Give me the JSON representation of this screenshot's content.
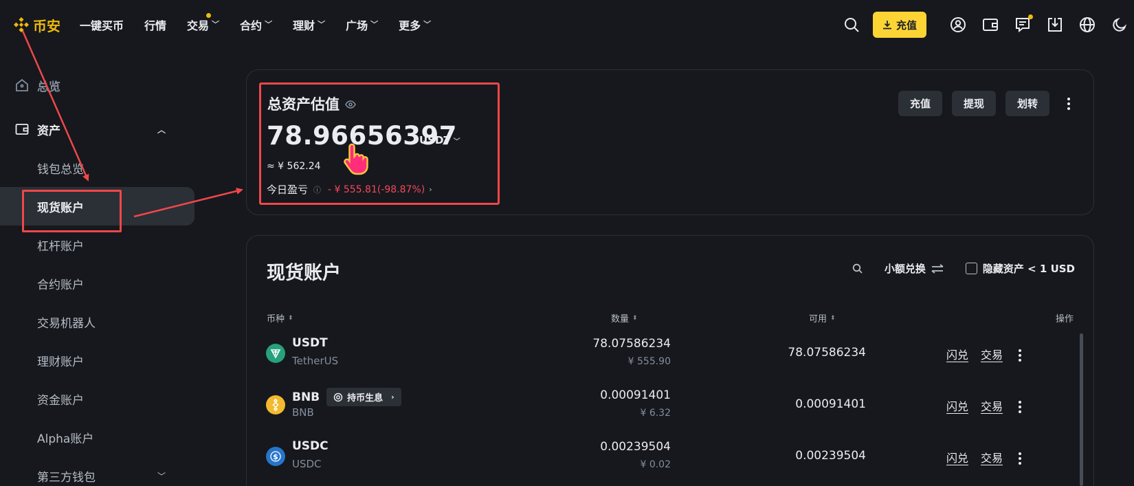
{
  "brand": {
    "name": "币安",
    "color": "#f0b90b"
  },
  "nav": {
    "items": [
      {
        "label": "一键买币",
        "dropdown": false,
        "dot": false
      },
      {
        "label": "行情",
        "dropdown": false,
        "dot": false
      },
      {
        "label": "交易",
        "dropdown": true,
        "dot": true
      },
      {
        "label": "合约",
        "dropdown": true,
        "dot": false
      },
      {
        "label": "理财",
        "dropdown": true,
        "dot": false
      },
      {
        "label": "广场",
        "dropdown": true,
        "dot": false
      },
      {
        "label": "更多",
        "dropdown": true,
        "dot": false
      }
    ],
    "deposit_label": "充值",
    "icons": [
      "search-icon",
      "download-icon",
      "user-icon",
      "wallet-icon",
      "message-icon",
      "download-app-icon",
      "globe-icon",
      "moon-icon"
    ]
  },
  "sidebar": {
    "overview": "总览",
    "assets": "资产",
    "sub_items": [
      "钱包总览",
      "现货账户",
      "杠杆账户",
      "合约账户",
      "交易机器人",
      "理财账户",
      "资金账户",
      "Alpha账户",
      "第三方钱包"
    ],
    "active": "现货账户"
  },
  "estimate": {
    "title": "总资产估值",
    "value": "78.96656397",
    "unit": "USDT",
    "cny": "≈ ¥ 562.24",
    "pnl_label": "今日盈亏",
    "pnl_value": "- ¥ 555.81(-98.87%)",
    "buttons": [
      "充值",
      "提现",
      "划转"
    ]
  },
  "spot": {
    "title": "现货账户",
    "dust_label": "小额兑换",
    "hide_label": "隐藏资产 < 1 USD",
    "columns": {
      "coin": "币种",
      "amount": "数量",
      "available": "可用",
      "action": "操作"
    },
    "rows": [
      {
        "symbol": "USDT",
        "name": "TetherUS",
        "amount": "78.07586234",
        "cny": "¥ 555.90",
        "available": "78.07586234",
        "tag": "",
        "color": "#26a17b"
      },
      {
        "symbol": "BNB",
        "name": "BNB",
        "amount": "0.00091401",
        "cny": "¥ 6.32",
        "available": "0.00091401",
        "tag": "持币生息",
        "color": "#f3ba2f"
      },
      {
        "symbol": "USDC",
        "name": "USDC",
        "amount": "0.00239504",
        "cny": "¥ 0.02",
        "available": "0.00239504",
        "tag": "",
        "color": "#2775ca"
      }
    ],
    "actions": [
      "闪兑",
      "交易"
    ]
  },
  "colors": {
    "accent": "#fcd535",
    "negative": "#f6465d",
    "annotation": "#f0474a"
  }
}
